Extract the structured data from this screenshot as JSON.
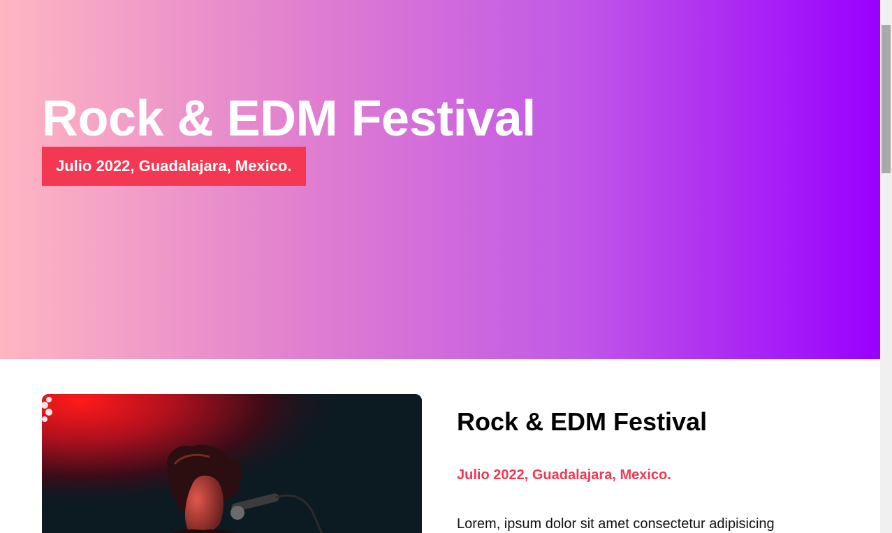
{
  "hero": {
    "title": "Rock & EDM Festival",
    "badge": "Julio 2022, Guadalajara, Mexico."
  },
  "content": {
    "image_alt": "singer performing on stage",
    "title": "Rock & EDM Festival",
    "date": "Julio 2022, Guadalajara, Mexico.",
    "text": "Lorem, ipsum dolor sit amet consectetur adipisicing"
  },
  "colors": {
    "accent": "#f43752",
    "gradient_start": "#ffb6c1",
    "gradient_end": "#9900ff"
  }
}
